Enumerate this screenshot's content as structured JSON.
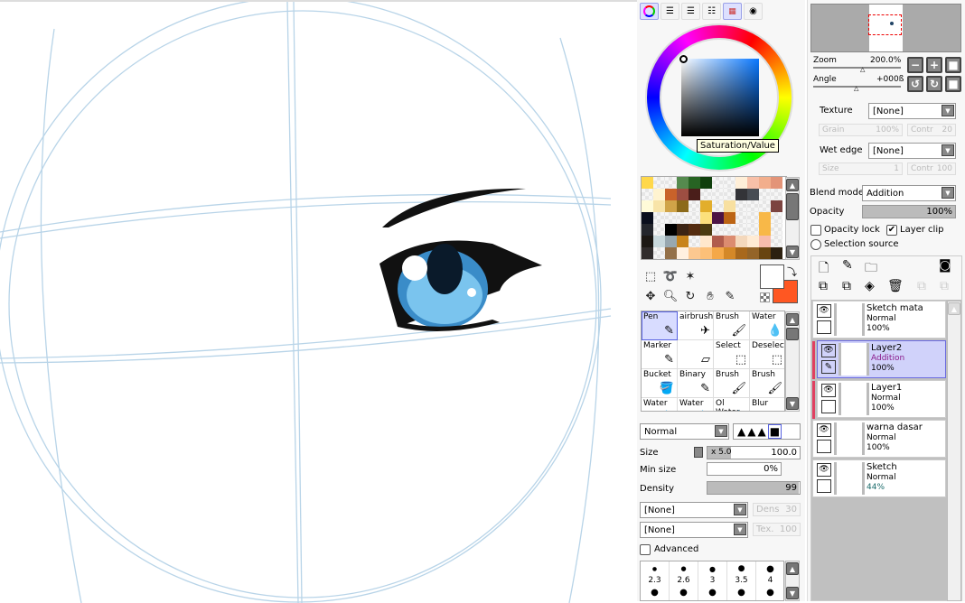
{
  "color_panel": {
    "mode_buttons": [
      "color-wheel",
      "rgb-sliders",
      "hsv-sliders",
      "intermediate-bars",
      "swatches",
      "scratchpad"
    ],
    "tooltip": "Saturation/Value",
    "swatches": [
      [
        "#FFD84A",
        "",
        "",
        "#558A4E",
        "#276423",
        "#0F3F0C",
        "",
        "",
        "#FFEFD8",
        "#F8C0A8",
        "#F2AE8C",
        "#E39478"
      ],
      [
        "",
        "#FFF3D0",
        "#C9622A",
        "#9D4E42",
        "#4A1E1A",
        "",
        "",
        "",
        "#333438",
        "#474C53",
        "",
        ""
      ],
      [
        "#FFFBD8",
        "#F8E4A8",
        "#D0A448",
        "#8C6A1A",
        "",
        "#E2AE2C",
        "",
        "#F8E0A0",
        "",
        "",
        "",
        "#7C4440"
      ],
      [
        "#0A0E1C",
        "",
        "",
        "",
        "",
        "#FCE07C",
        "#4C1444",
        "#BC6414",
        "",
        "",
        "#F8B848",
        ""
      ],
      [
        "#24262C",
        "",
        "#000000",
        "#3C2414",
        "#542C10",
        "#4C3C10",
        "",
        "",
        "",
        "",
        "#F8B848",
        ""
      ],
      [
        "#1C1814",
        "#C8D8DC",
        "#98A8B0",
        "#C8841C",
        "",
        "#FFE8CC",
        "#B05C4C",
        "#DC8C70",
        "#F4D8BC",
        "#FFEBD4",
        "#F8BCAC",
        ""
      ],
      [
        "#302C2C",
        "",
        "#947048",
        "#FFF0E0",
        "#FCC890",
        "#FCC078",
        "#F4A848",
        "#D48828",
        "#A8681C",
        "#946428",
        "#684410",
        "#2C2010"
      ]
    ],
    "primary_color": "#FFFFFF",
    "secondary_color": "#FF5722"
  },
  "tools": {
    "items": [
      "Pen",
      "airbrush",
      "Brush",
      "Water",
      "Marker",
      "",
      "Select",
      "Deselect",
      "Bucket",
      "Binary",
      "Brush",
      "Brush",
      "Water",
      "Water",
      "Ol Water",
      "Blur"
    ],
    "blend": "Normal",
    "size_label": "Size",
    "size_mult": "x 5.0",
    "size_value": "100.0",
    "min_size_label": "Min size",
    "min_size_value": "0%",
    "density_label": "Density",
    "density_value": "99",
    "tex1": "[None]",
    "dens_label": "Dens",
    "dens_value": "30",
    "tex2": "[None]",
    "tex_label": "Tex.",
    "tex_value": "100",
    "advanced_label": "Advanced",
    "brush_sizes": [
      "2.3",
      "2.6",
      "3",
      "3.5",
      "4"
    ]
  },
  "navigator": {
    "zoom_label": "Zoom",
    "zoom_value": "200.0%",
    "angle_label": "Angle",
    "angle_value": "+000ß"
  },
  "layer_props": {
    "texture_label": "Texture",
    "texture_value": "[None]",
    "grain_label": "Grain",
    "grain_value": "100%",
    "contr_label": "Contr",
    "contr_value": "20",
    "wet_label": "Wet edge",
    "wet_value": "[None]",
    "wsize_label": "Size",
    "wsize_value": "1",
    "wcontr_label": "Contr",
    "wcontr_value": "100",
    "blend_label": "Blend mode",
    "blend_value": "Addition",
    "opacity_label": "Opacity",
    "opacity_value": "100%",
    "opacity_lock": "Opacity lock",
    "layer_clip": "Layer clip",
    "selection_source": "Selection source"
  },
  "layers": [
    {
      "name": "Sketch mata",
      "mode": "Normal",
      "opacity": "100%",
      "selected": false,
      "clip": false
    },
    {
      "name": "Layer2",
      "mode": "Addition",
      "opacity": "100%",
      "selected": true,
      "clip": true
    },
    {
      "name": "Layer1",
      "mode": "Normal",
      "opacity": "100%",
      "selected": false,
      "clip": true
    },
    {
      "name": "warna dasar",
      "mode": "Normal",
      "opacity": "100%",
      "selected": false,
      "clip": false
    },
    {
      "name": "Sketch",
      "mode": "Normal",
      "opacity": "44%",
      "selected": false,
      "clip": false
    }
  ]
}
